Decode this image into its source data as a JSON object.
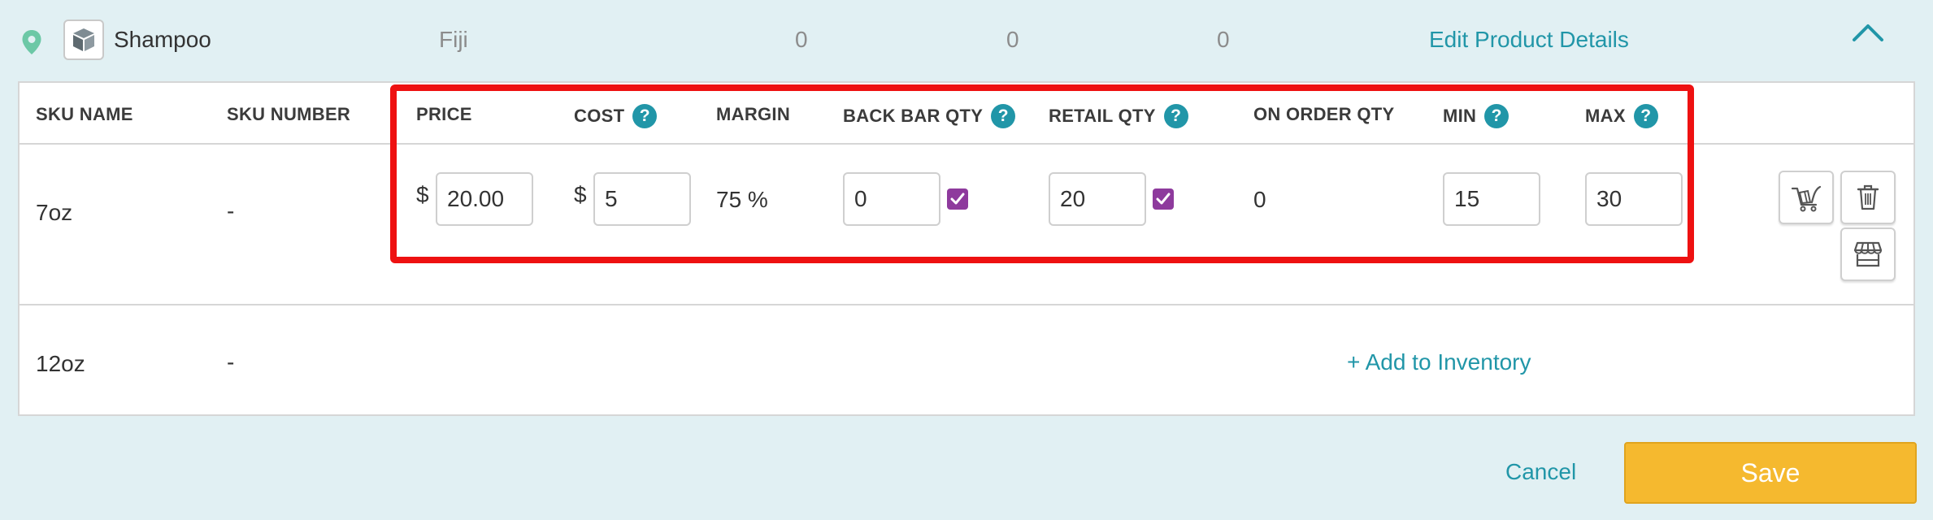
{
  "product": {
    "name": "Shampoo",
    "vendor": "Fiji",
    "counts": [
      "0",
      "0",
      "0"
    ],
    "edit_label": "Edit Product Details"
  },
  "table": {
    "headers": {
      "sku_name": "SKU NAME",
      "sku_number": "SKU NUMBER",
      "price": "PRICE",
      "cost": "COST",
      "margin": "MARGIN",
      "back_bar_qty": "BACK BAR QTY",
      "retail_qty": "RETAIL QTY",
      "on_order_qty": "ON ORDER QTY",
      "min": "MIN",
      "max": "MAX"
    },
    "help_glyph": "?",
    "currency_symbol": "$",
    "rows": [
      {
        "sku_name": "7oz",
        "sku_number": "-",
        "price": "20.00",
        "cost": "5",
        "margin": "75 %",
        "back_bar_qty": "0",
        "back_bar_checked": true,
        "retail_qty": "20",
        "retail_checked": true,
        "on_order_qty": "0",
        "min": "15",
        "max": "30"
      },
      {
        "sku_name": "12oz",
        "sku_number": "-",
        "add_label": "+ Add to Inventory"
      }
    ]
  },
  "footer": {
    "cancel_label": "Cancel",
    "save_label": "Save"
  },
  "colors": {
    "background": "#e1f0f3",
    "accent": "#2196a8",
    "save": "#f5b92f",
    "checkbox": "#8e3a9d",
    "highlight": "#ee1111"
  },
  "icons": [
    "location-pin-icon",
    "product-box-icon",
    "chevron-up-icon",
    "help-icon",
    "checkmark-icon",
    "cart-icon",
    "trash-icon",
    "store-icon"
  ]
}
